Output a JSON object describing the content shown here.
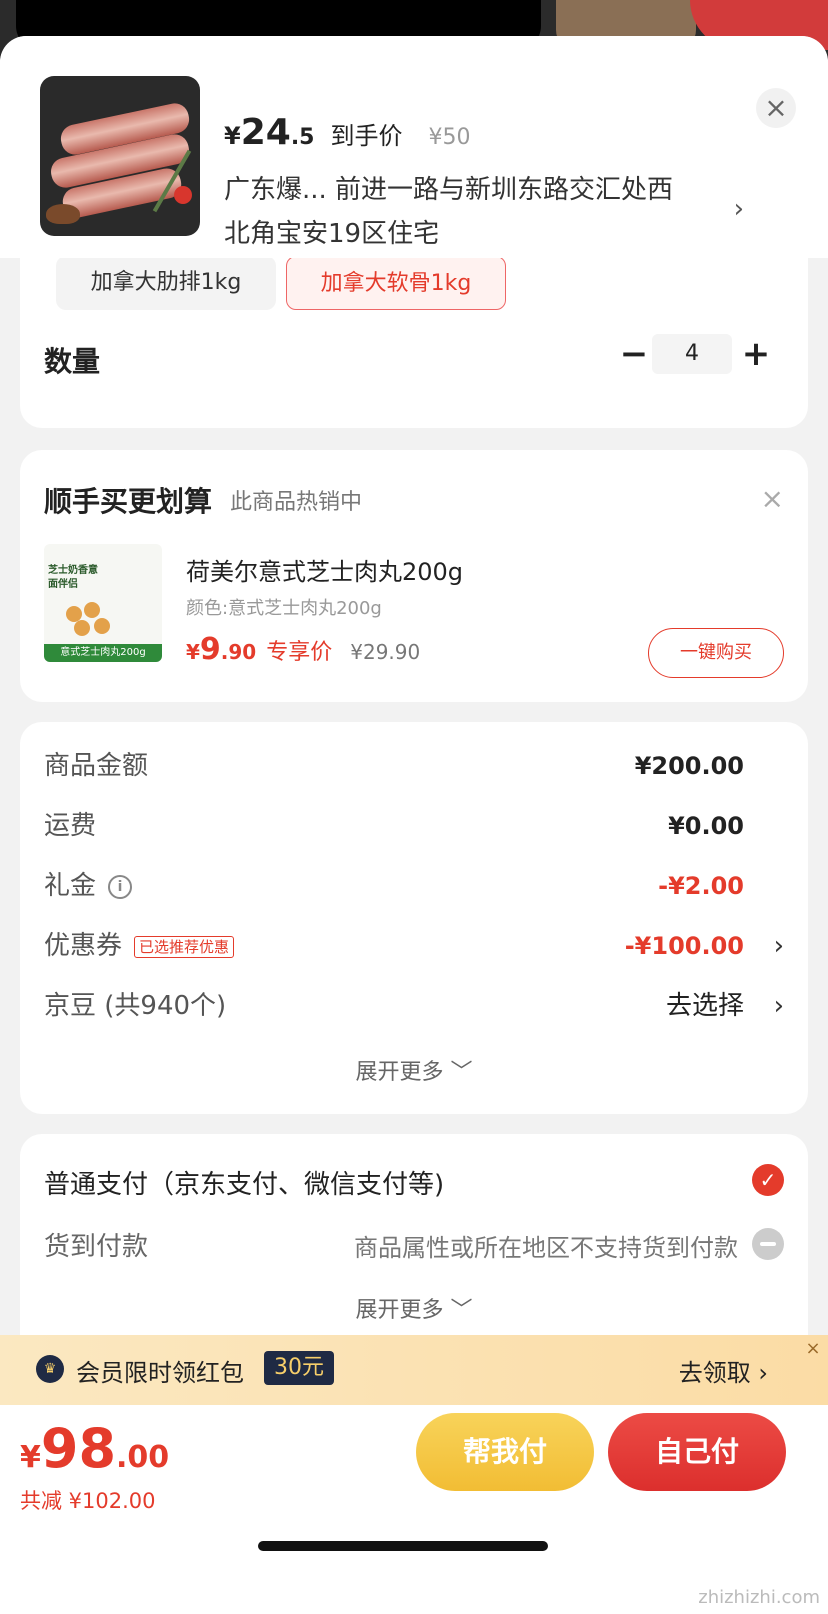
{
  "header": {
    "price_yen": "¥",
    "price_int": "24",
    "price_dec": ".5",
    "price_tag": "到手价",
    "original_price": "¥50",
    "address": "广东爆... 前进一路与新圳东路交汇处西北角宝安19区住宅",
    "close_icon": "close-icon",
    "arrow": "›"
  },
  "spec": {
    "options": [
      "加拿大肋排1kg",
      "加拿大软骨1kg"
    ],
    "selected_index": 1,
    "quantity_label": "数量",
    "quantity": "4",
    "minus": "−",
    "plus": "+"
  },
  "upsell": {
    "title": "顺手买更划算",
    "subtitle": "此商品热销中",
    "close": "×",
    "image_caption": "意式芝士肉丸200g",
    "image_text": "芝士奶香意面伴侣",
    "product_name": "荷美尔意式芝士肉丸200g",
    "color_spec": "颜色:意式芝士肉丸200g",
    "price_yen": "¥",
    "price_int": "9",
    "price_dec": ".90",
    "price_tag": "专享价",
    "original_price": "¥29.90",
    "buy_button": "一键购买"
  },
  "amounts": {
    "rows": [
      {
        "label": "商品金额",
        "value": "¥200.00"
      },
      {
        "label": "运费",
        "value": "¥0.00"
      },
      {
        "label": "礼金",
        "value": "-¥2.00"
      },
      {
        "label": "优惠券",
        "badge": "已选推荐优惠",
        "value": "-¥100.00"
      },
      {
        "label": "京豆 (共940个)",
        "value": "去选择"
      }
    ],
    "expand_more": "展开更多 ﹀"
  },
  "payment": {
    "normal": "普通支付（京东支付、微信支付等)",
    "cod": "货到付款",
    "cod_note": "商品属性或所在地区不支持货到付款",
    "expand_more": "展开更多 ﹀"
  },
  "banner": {
    "text": "会员限时领红包",
    "amount": "30元",
    "action": "去领取 ›",
    "close": "×"
  },
  "bottom": {
    "total_yen": "¥",
    "total_int": "98",
    "total_dec": ".00",
    "saved": "共减 ¥102.00",
    "help_pay": "帮我付",
    "self_pay": "自己付"
  },
  "watermark": "zhizhizhi.com",
  "colors": {
    "accent": "#e43b2b",
    "help": "#f2bd34",
    "banner": "#fbe8c1"
  }
}
